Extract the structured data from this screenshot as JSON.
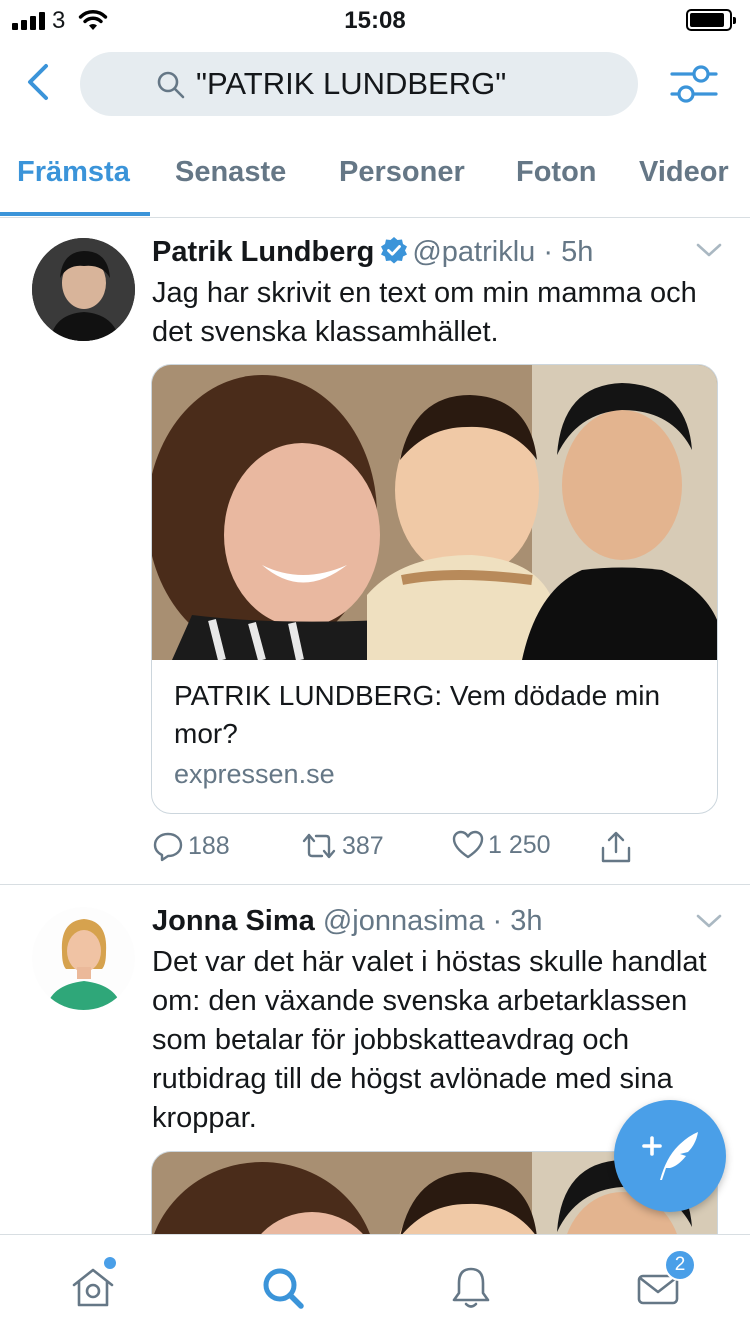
{
  "status_bar": {
    "carrier": "3",
    "time": "15:08"
  },
  "search": {
    "query": "\"PATRIK LUNDBERG\""
  },
  "tabs": [
    "Främsta",
    "Senaste",
    "Personer",
    "Foton",
    "Videor"
  ],
  "tweets": [
    {
      "name": "Patrik Lundberg",
      "verified": true,
      "handle": "@patriklu",
      "time": "5h",
      "text": "Jag har skrivit en text om min mamma och det svenska klassamhället.",
      "card": {
        "title": "PATRIK LUNDBERG: Vem dödade min mor?",
        "domain": "expressen.se"
      },
      "actions": {
        "replies": "188",
        "retweets": "387",
        "likes": "1 250"
      }
    },
    {
      "name": "Jonna Sima",
      "verified": false,
      "handle": "@jonnasima",
      "time": "3h",
      "text": "Det var det här valet i höstas skulle handlat om: den växande svenska arbetarklassen som betalar för jobbskatteavdrag och rutbidrag till de högst avlönade med sina kroppar."
    }
  ],
  "tabbar": {
    "messages_badge": "2"
  },
  "colors": {
    "accent": "#3b94d9",
    "fab": "#4a9fe8",
    "secondary_text": "#657786"
  }
}
